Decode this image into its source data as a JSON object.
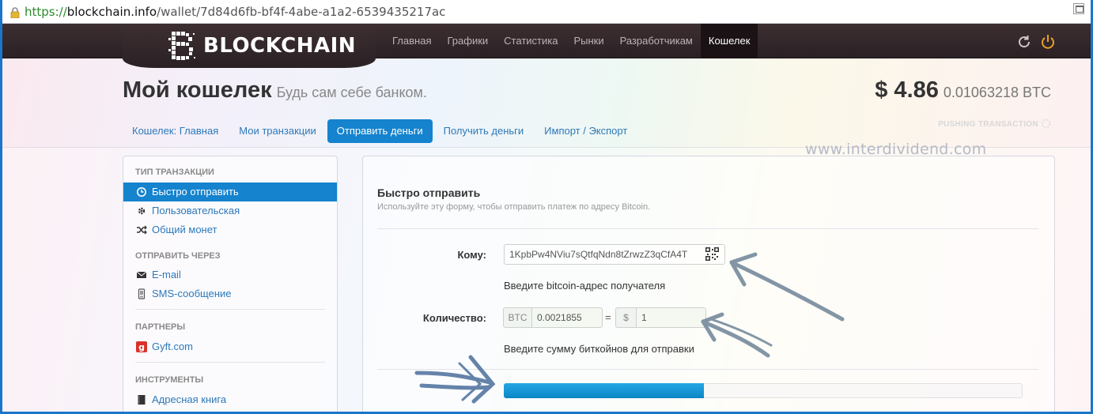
{
  "browser": {
    "url_scheme": "https://",
    "url_host": "blockchain.info",
    "url_path": "/wallet/7d84d6fb-bf4f-4abe-a1a2-6539435217ac"
  },
  "nav": {
    "brand": "BLOCKCHAIN",
    "items": [
      "Главная",
      "Графики",
      "Статистика",
      "Рынки",
      "Разработчикам",
      "Кошелек"
    ],
    "active_index": 5
  },
  "header": {
    "title": "Мой кошелек",
    "subtitle": "Будь сам себе банком.",
    "balance_usd": "$ 4.86",
    "balance_btc": "0.01063218 BTC",
    "status": "PUSHING TRANSACTION"
  },
  "tabs": [
    "Кошелек: Главная",
    "Мои транзакции",
    "Отправить деньги",
    "Получить деньги",
    "Импорт / Экспорт"
  ],
  "watermark": "www.interdividend.com",
  "sidebar": {
    "sections": [
      {
        "heading": "ТИП ТРАНЗАКЦИИ",
        "items": [
          "Быстро отправить",
          "Пользовательская",
          "Общий монет"
        ]
      },
      {
        "heading": "ОТПРАВИТЬ ЧЕРЕЗ",
        "items": [
          "E-mail",
          "SMS-сообщение"
        ]
      },
      {
        "heading": "ПАРТНЕРЫ",
        "items": [
          "Gyft.com"
        ]
      },
      {
        "heading": "ИНСТРУМЕНТЫ",
        "items": [
          "Адресная книга"
        ]
      }
    ]
  },
  "form": {
    "title": "Быстро отправить",
    "description": "Используйте эту форму, чтобы отправить платеж по адресу Bitcoin.",
    "to_label": "Кому:",
    "to_value": "1KpbPw4NViu7sQtfqNdn8tZrwzZ3qCfA4T",
    "to_help": "Введите bitcoin-адрес получателя",
    "amount_label": "Количество:",
    "btc_unit": "BTC",
    "btc_value": "0.0021855",
    "equals": "=",
    "usd_unit": "$",
    "usd_value": "1",
    "amount_help": "Введите сумму биткойнов для отправки",
    "progress": 0.385
  },
  "colors": {
    "accent": "#1583ce",
    "nav_bg": "#3d2f32",
    "power": "#e8a02a"
  }
}
